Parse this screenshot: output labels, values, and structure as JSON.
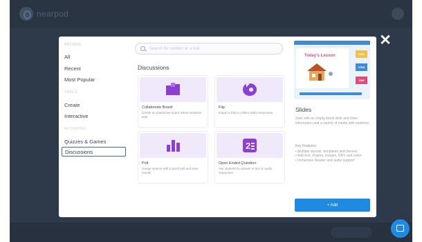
{
  "app": {
    "brand_name": "nearpod"
  },
  "modal": {
    "close_glyph": "✕",
    "sidebar": {
      "groups": [
        {
          "label": "Browse",
          "items": [
            "All",
            "Recent",
            "Most Popular"
          ]
        },
        {
          "label": "Tools",
          "items": [
            "Create",
            "Interactive"
          ]
        },
        {
          "label": "Activities",
          "items": [
            "Quizzes & Games",
            "Discussions"
          ]
        }
      ],
      "active_item": "Discussions"
    },
    "search": {
      "placeholder": "Search for content or a tool"
    },
    "section_title": "Discussions",
    "tiles": [
      {
        "title": "Collaborate Board",
        "desc": "Create an interactive board where students post",
        "icon": "collaborate-board-icon",
        "color": "#8c3fd0"
      },
      {
        "title": "Flip",
        "desc": "Import a Flip to collect video responses",
        "icon": "flip-icon",
        "color": "#8c3fd0"
      },
      {
        "title": "Poll",
        "desc": "Gauge opinion with a quick poll and view results",
        "icon": "poll-icon",
        "color": "#8c3fd0"
      },
      {
        "title": "Open Ended Question",
        "desc": "Ask students to answer in text or audio responses",
        "icon": "open-ended-question-icon",
        "color": "#8c3fd0"
      }
    ],
    "preview": {
      "title": "Today's Lesson",
      "chips": [
        "IDEA",
        "STEM",
        "TIME"
      ],
      "chip_colors": [
        "#f2c14b",
        "#3f8ad3",
        "#d94c7c"
      ]
    },
    "info": {
      "title": "Slides",
      "text": "Start with an empty blank slide and draw information and a variety of media with students.",
      "features_title": "Key Features:",
      "features": [
        "• Multiple layouts, templates and themes",
        "• Add text, shapes, images, GIFs and video",
        "• Immersive Reader and audio support"
      ]
    },
    "add_button": "+ Add"
  },
  "colors": {
    "accent": "#1f8be0",
    "tile_art_bg": "#efe9fb",
    "tile_icon": "#8c3fd0",
    "backdrop": "#2e3a4a"
  }
}
